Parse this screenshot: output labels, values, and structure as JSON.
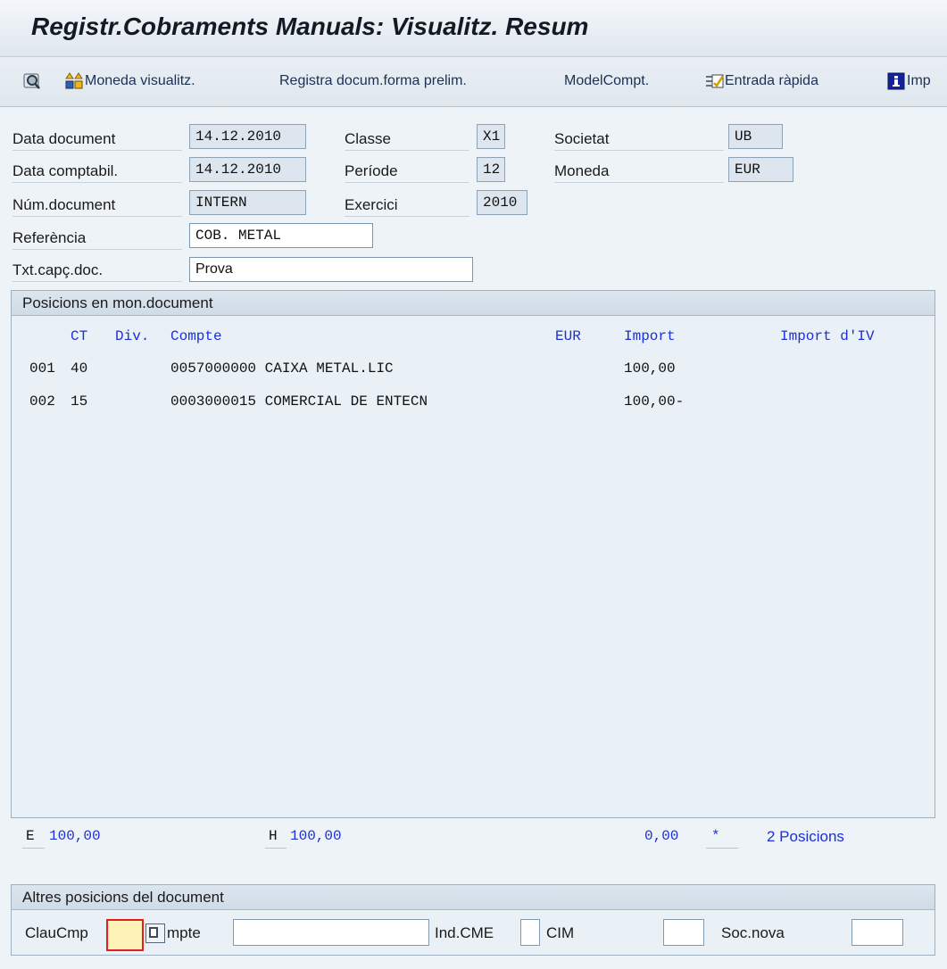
{
  "window": {
    "title": "Registr.Cobraments Manuals: Visualitz. Resum"
  },
  "toolbar": {
    "items": [
      {
        "label": "",
        "icon": "display-magnifier-icon"
      },
      {
        "label": "Moneda visualitz.",
        "icon": "currency-toggle-icon"
      },
      {
        "label": "Registra docum.forma prelim.",
        "icon": ""
      },
      {
        "label": "ModelCompt.",
        "icon": ""
      },
      {
        "label": "Entrada ràpida",
        "icon": "fast-entry-icon"
      },
      {
        "label": "Imp",
        "icon": "info-icon"
      }
    ]
  },
  "header": {
    "data_document": {
      "label": "Data document",
      "value": "14.12.2010"
    },
    "data_comptabil": {
      "label": "Data comptabil.",
      "value": "14.12.2010"
    },
    "num_document": {
      "label": "Núm.document",
      "value": "INTERN"
    },
    "referencia": {
      "label": "Referència",
      "value": "COB. METAL"
    },
    "txt_capc": {
      "label": "Txt.capç.doc.",
      "value": "Prova"
    },
    "classe": {
      "label": "Classe",
      "value": "X1"
    },
    "periode": {
      "label": "Període",
      "value": "12"
    },
    "exercici": {
      "label": "Exercici",
      "value": "2010"
    },
    "societat": {
      "label": "Societat",
      "value": "UB"
    },
    "moneda": {
      "label": "Moneda",
      "value": "EUR"
    }
  },
  "positions": {
    "title": "Posicions en mon.document",
    "columns": {
      "ct": "CT",
      "div": "Div.",
      "compte": "Compte",
      "eur": "EUR",
      "import": "Import",
      "import_iva": "Import d'IV"
    },
    "rows": [
      {
        "pos": "001",
        "ct": "40",
        "compte": "0057000000 CAIXA METAL.LIC",
        "import": "100,00"
      },
      {
        "pos": "002",
        "ct": "15",
        "compte": "0003000015 COMERCIAL DE ENTECN",
        "import": "100,00-"
      }
    ],
    "totals": {
      "e_label": "E",
      "e_value": "100,00",
      "h_label": "H",
      "h_value": "100,00",
      "balance": "0,00",
      "star": "*",
      "count": "2 Posicions"
    }
  },
  "other_positions": {
    "title": "Altres posicions del document",
    "claucmp_label": "ClauCmp",
    "claucmp_value": "",
    "compte_label": "mpte",
    "compte_value": "",
    "ind_cme_label": "Ind.CME",
    "cim_label": "CIM",
    "soc_nova_label": "Soc.nova"
  },
  "colors": {
    "accent_blue": "#1d2fd6",
    "focus_red": "#e0201e",
    "focus_fill": "#fff2b8"
  }
}
